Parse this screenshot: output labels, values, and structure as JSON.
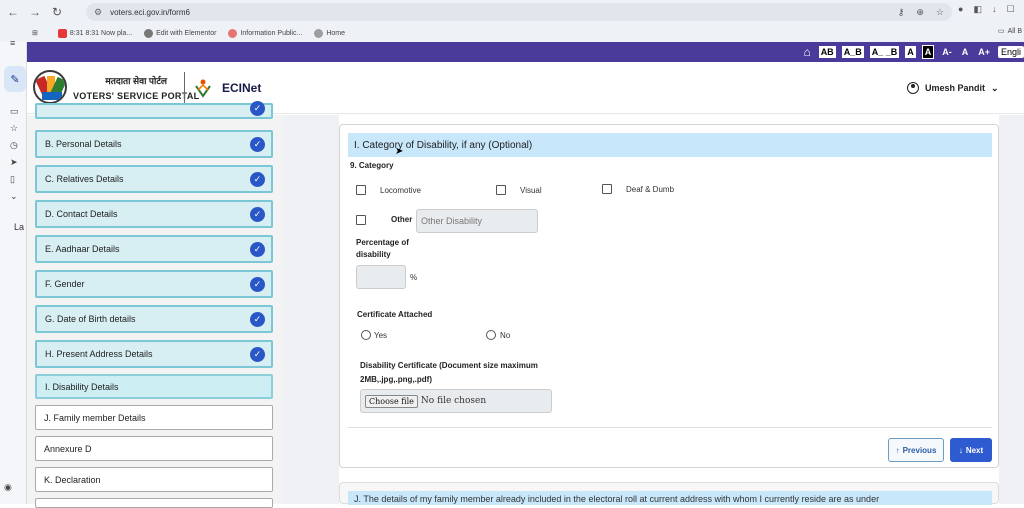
{
  "browser": {
    "url": "voters.eci.gov.in/form6",
    "bookmarks": [
      {
        "label": "8:31 8:31 Now pla...",
        "color": "#e53935"
      },
      {
        "label": "Edit with Elementor",
        "color": "#666666"
      },
      {
        "label": "Information Public...",
        "color": "#e57373"
      },
      {
        "label": "Home",
        "color": "#9e9e9e"
      }
    ],
    "all_bookmarks": "All B"
  },
  "sidebar_label": "La",
  "accessibility": {
    "items": [
      "AB",
      "A_B",
      "A_ _B",
      "A",
      "A",
      "A-",
      "A",
      "A+"
    ],
    "language": "Engli"
  },
  "header": {
    "hindi_title": "मतदाता सेवा पोर्टल",
    "portal_name": "VOTERS' SERVICE PORTAL",
    "ecinet": "ECINet",
    "user_name": "Umesh Pandit"
  },
  "steps": [
    {
      "label": "B. Personal Details",
      "state": "done"
    },
    {
      "label": "C. Relatives Details",
      "state": "done"
    },
    {
      "label": "D. Contact Details",
      "state": "done"
    },
    {
      "label": "E. Aadhaar Details",
      "state": "done"
    },
    {
      "label": "F. Gender",
      "state": "done"
    },
    {
      "label": "G. Date of Birth details",
      "state": "done"
    },
    {
      "label": "H. Present Address Details",
      "state": "done"
    },
    {
      "label": "I. Disability Details",
      "state": "active"
    },
    {
      "label": "J. Family member Details",
      "state": "todo"
    },
    {
      "label": "Annexure D",
      "state": "todo"
    },
    {
      "label": "K. Declaration",
      "state": "todo"
    }
  ],
  "form": {
    "section_title": "I. Category of Disability, if any (Optional)",
    "category_label": "9. Category",
    "options": {
      "locomotive": "Locomotive",
      "visual": "Visual",
      "deaf_dumb": "Deaf & Dumb",
      "other": "Other"
    },
    "other_placeholder": "Other Disability",
    "percentage_label_1": "Percentage of",
    "percentage_label_2": "disability",
    "percent_sign": "%",
    "certificate_label": "Certificate Attached",
    "yes": "Yes",
    "no": "No",
    "upload_label_1": "Disability Certificate (Document size maximum",
    "upload_label_2": "2MB,.jpg,.png,.pdf)",
    "choose_file": "Choose file",
    "no_file": "No file chosen",
    "previous": "Previous",
    "next": "Next"
  },
  "next_section_title": "J. The details of my family member already included in the electoral roll at current address with whom I currently reside are as under"
}
